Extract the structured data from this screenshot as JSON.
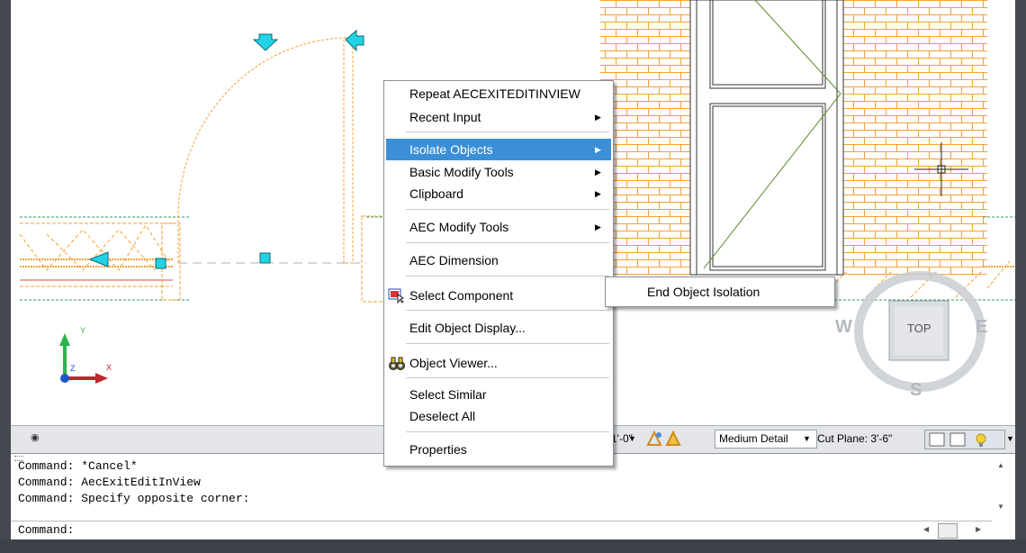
{
  "context_menu": {
    "items": [
      {
        "label": "Repeat AECEXITEDITINVIEW",
        "submenu": false
      },
      {
        "label": "Recent Input",
        "submenu": true
      },
      {
        "label": "Isolate Objects",
        "submenu": true,
        "active": true
      },
      {
        "label": "Basic Modify Tools",
        "submenu": true
      },
      {
        "label": "Clipboard",
        "submenu": true
      },
      {
        "label": "AEC Modify Tools",
        "submenu": true
      },
      {
        "label": "AEC Dimension",
        "submenu": false
      },
      {
        "label": "Select Component",
        "submenu": false,
        "icon": "select-component-icon"
      },
      {
        "label": "Edit Object Display...",
        "submenu": false
      },
      {
        "label": "Object Viewer...",
        "submenu": false,
        "icon": "binoculars-icon"
      },
      {
        "label": "Select Similar",
        "submenu": false
      },
      {
        "label": "Deselect All",
        "submenu": false
      },
      {
        "label": "Properties",
        "submenu": false
      }
    ]
  },
  "submenu": {
    "items": [
      {
        "label": "End Object Isolation"
      }
    ]
  },
  "viewcube": {
    "top": "TOP",
    "west": "W",
    "east": "E",
    "south": "S"
  },
  "viewport_bar": {
    "scale": "1'-0\"",
    "detail": "Medium Detail",
    "cut_plane": "Cut Plane: 3'-6\""
  },
  "command_window": {
    "history": [
      "Command: *Cancel*",
      "Command: AecExitEditInView",
      "Command: Specify opposite corner:"
    ],
    "prompt": "Command:"
  },
  "ucs": {
    "x": "X",
    "y": "Y",
    "z": "Z"
  },
  "colors": {
    "accent": "#3a8fd6",
    "brick": "#f6a033",
    "grip": "#22d3e6"
  }
}
